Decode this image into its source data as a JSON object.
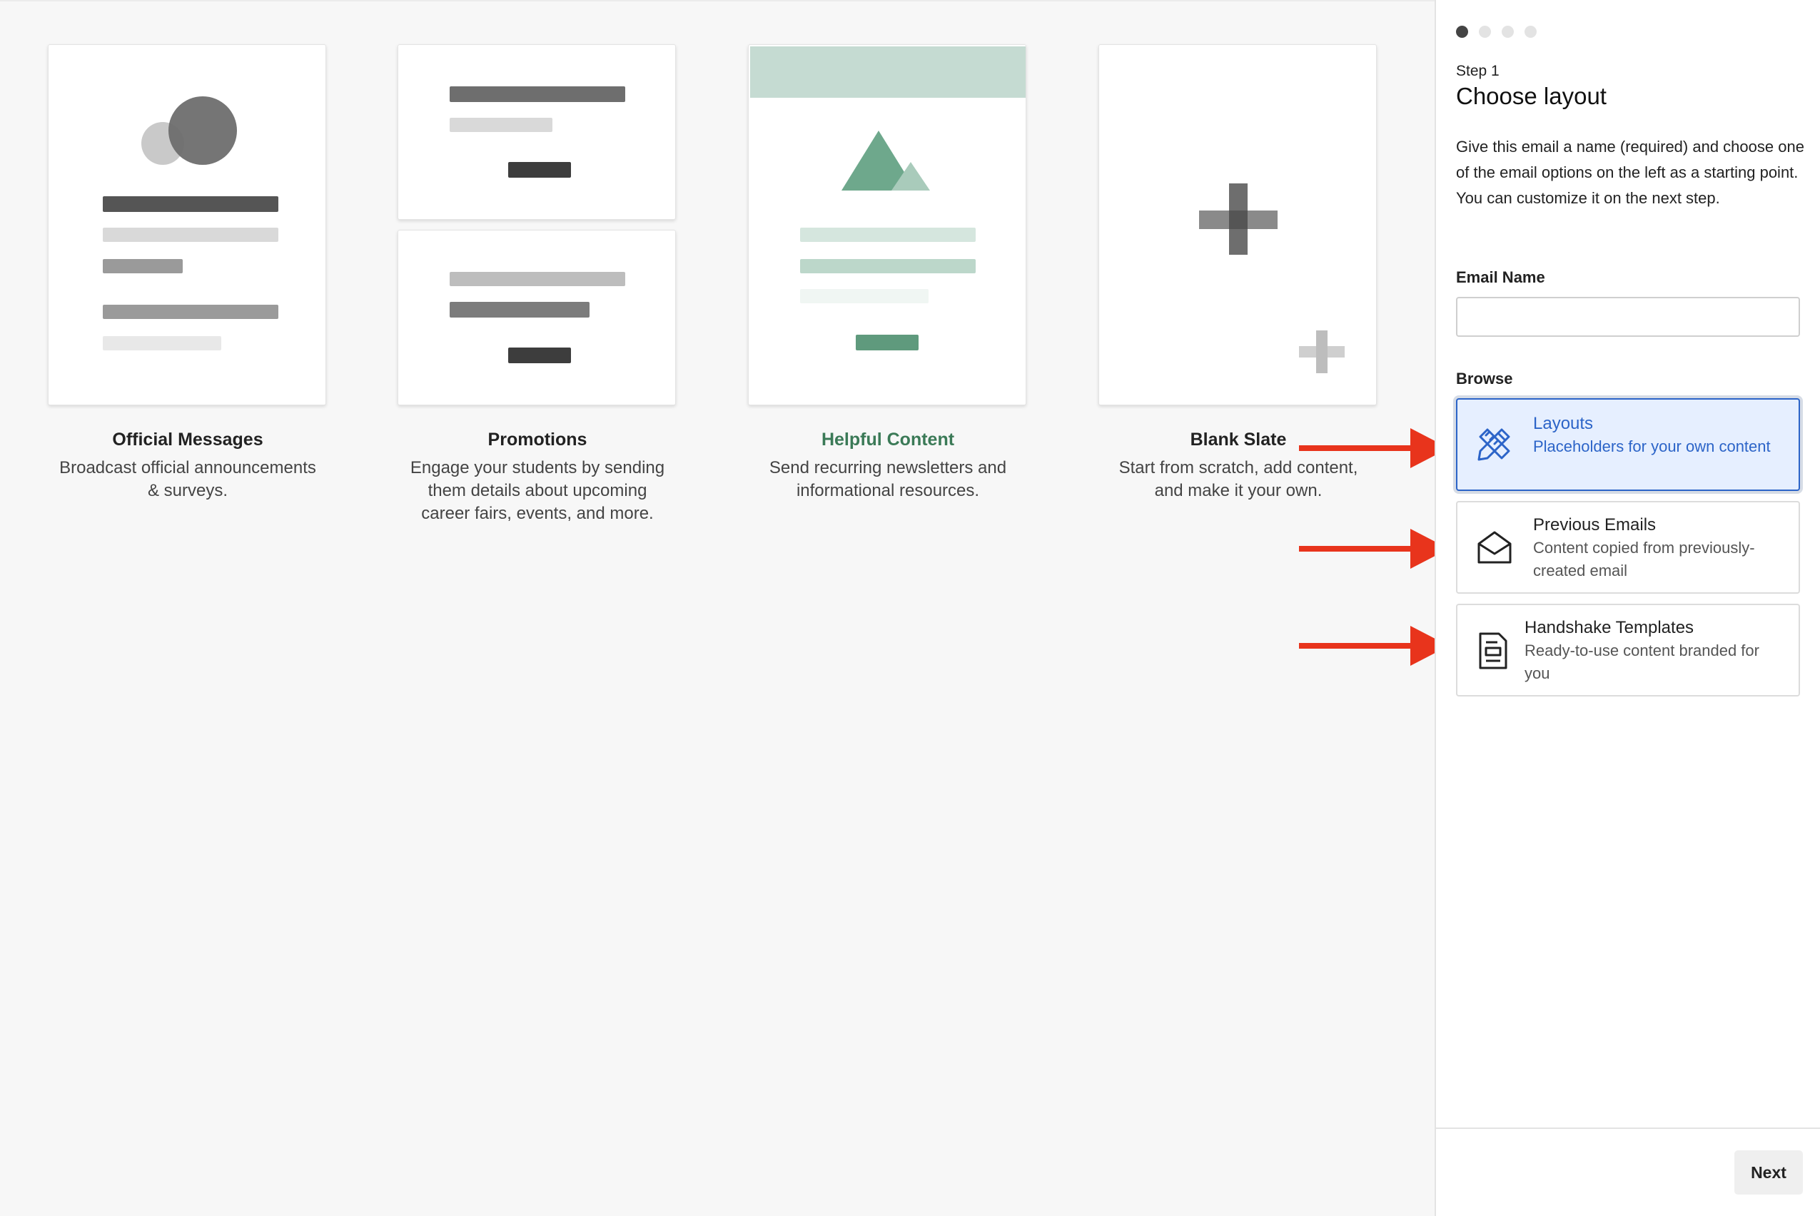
{
  "cards": [
    {
      "title": "Official Messages",
      "description": "Broadcast official announcements & surveys."
    },
    {
      "title": "Promotions",
      "description": "Engage your students by sending them details about upcoming career fairs, events, and more."
    },
    {
      "title": "Helpful Content",
      "description": "Send recurring newsletters and informational resources."
    },
    {
      "title": "Blank Slate",
      "description": "Start from scratch, add content, and make it your own."
    }
  ],
  "panel": {
    "step_label": "Step 1",
    "title": "Choose layout",
    "description": "Give this email a name (required) and choose one of the email options on the left as a starting point. You can customize it on the next step.",
    "email_name_label": "Email Name",
    "email_name_value": "",
    "browse_label": "Browse",
    "options": [
      {
        "title": "Layouts",
        "subtitle": "Placeholders for your own content",
        "icon": "pencil-ruler-icon",
        "selected": true
      },
      {
        "title": "Previous Emails",
        "subtitle": "Content copied from previously-created email",
        "icon": "open-envelope-icon",
        "selected": false
      },
      {
        "title": "Handshake Templates",
        "subtitle": "Ready-to-use content branded for you",
        "icon": "document-template-icon",
        "selected": false
      }
    ],
    "next_label": "Next"
  },
  "colors": {
    "accent_blue": "#2c64c8",
    "green": "#3b7a57",
    "arrow_red": "#e8341c"
  }
}
